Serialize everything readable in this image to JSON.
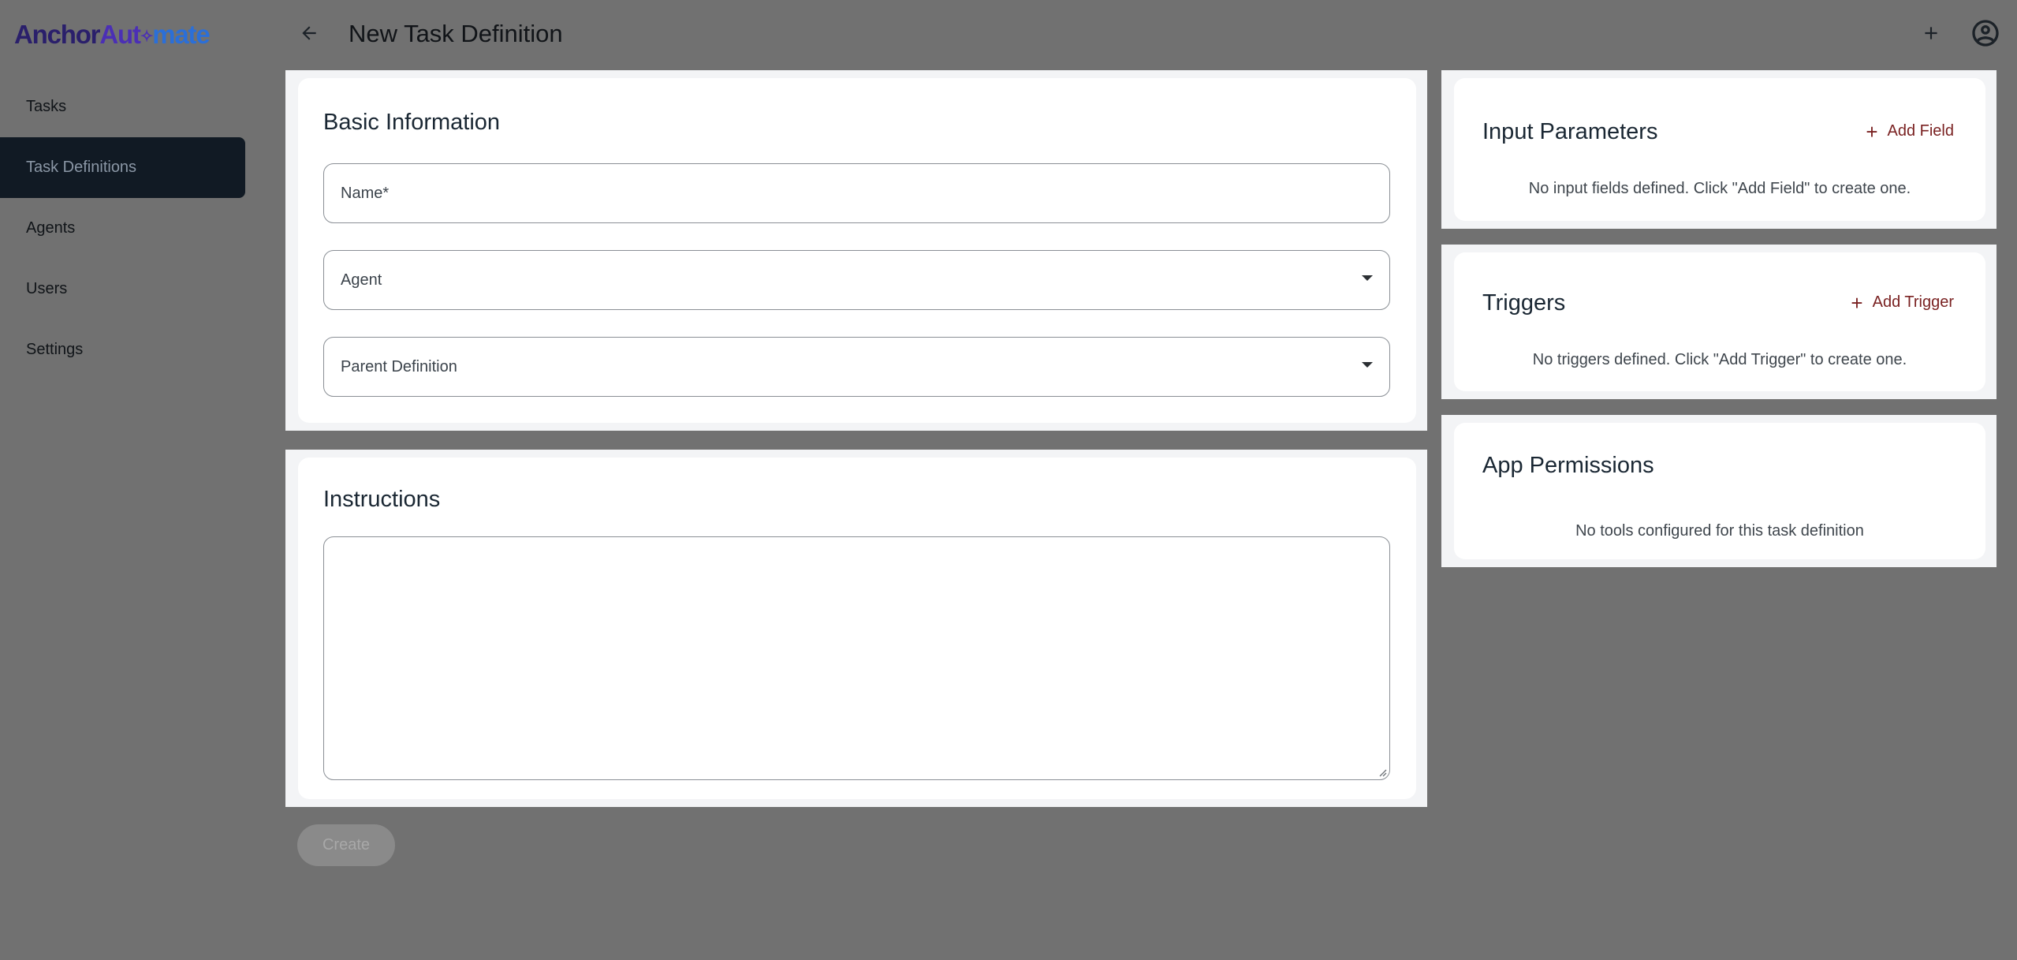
{
  "app": {
    "logo": {
      "part1": "Anchor",
      "part2": "Aut",
      "part3": "✧",
      "part4": "mate"
    }
  },
  "sidebar": {
    "items": [
      {
        "label": "Tasks"
      },
      {
        "label": "Task Definitions",
        "active": true
      },
      {
        "label": "Agents"
      },
      {
        "label": "Users"
      },
      {
        "label": "Settings"
      }
    ]
  },
  "header": {
    "title": "New Task Definition",
    "icons": {
      "back": "arrow-left-icon",
      "add": "plus-icon",
      "account": "account-circle-icon"
    }
  },
  "basic_info": {
    "title": "Basic Information",
    "name_label": "Name*",
    "name_value": "",
    "agent_label": "Agent",
    "agent_value": "",
    "parent_label": "Parent Definition",
    "parent_value": ""
  },
  "instructions": {
    "title": "Instructions",
    "value": ""
  },
  "input_parameters": {
    "title": "Input Parameters",
    "add_label": "Add Field",
    "empty_text": "No input fields defined. Click \"Add Field\" to create one."
  },
  "triggers": {
    "title": "Triggers",
    "add_label": "Add Trigger",
    "empty_text": "No triggers defined. Click \"Add Trigger\" to create one."
  },
  "app_permissions": {
    "title": "App Permissions",
    "empty_text": "No tools configured for this task definition"
  },
  "actions": {
    "create_label": "Create",
    "create_disabled": true
  },
  "colors": {
    "background": "#717171",
    "panel": "#f3f4f6",
    "card": "#ffffff",
    "sidebar_active": "#111a24",
    "accent_link": "#7a2222",
    "logo_dark": "#2a1f6b",
    "logo_purple": "#4b2fb5",
    "logo_blue": "#2b6fd8"
  }
}
